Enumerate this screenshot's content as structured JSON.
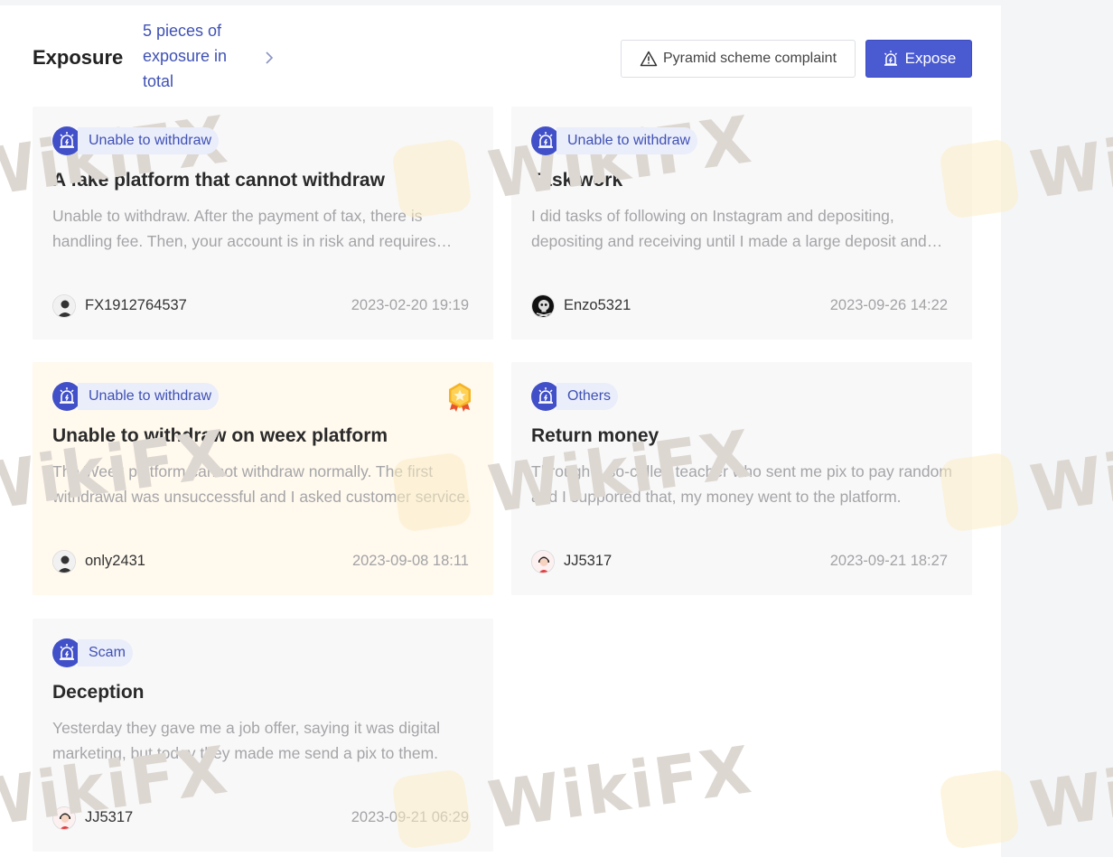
{
  "header": {
    "title": "Exposure",
    "summary": "5 pieces of exposure in total",
    "complaint_button": "Pyramid scheme complaint",
    "expose_button": "Expose"
  },
  "watermark": "WikiFX",
  "cards": [
    {
      "tag": "Unable to withdraw",
      "title": "A fake platform that cannot withdraw",
      "description": "Unable to withdraw. After the payment of tax, there is handling fee. Then, your account is in risk and requires verification fee.",
      "user": "FX1912764537",
      "time": "2023-02-20 19:19"
    },
    {
      "tag": "Unable to withdraw",
      "title": "Task work",
      "description": "I did tasks of following on Instagram and depositing, depositing and receiving until I made a large deposit and could not withdraw.",
      "user": "Enzo5321",
      "time": "2023-09-26 14:22"
    },
    {
      "tag": "Unable to withdraw",
      "title": "Unable to withdraw on weex platform",
      "description": "The Weex platform cannot withdraw normally. The first withdrawal was unsuccessful and I asked customer service.",
      "user": "only2431",
      "time": "2023-09-08 18:11"
    },
    {
      "tag": "Others",
      "title": "Return money",
      "description": "Through a so-called teacher who sent me pix to pay random and I supported that, my money went to the platform.",
      "user": "JJ5317",
      "time": "2023-09-21 18:27"
    },
    {
      "tag": "Scam",
      "title": "Deception",
      "description": "Yesterday they gave me a job offer, saying it was digital marketing, but today they made me send a pix to them.",
      "user": "JJ5317",
      "time": "2023-09-21 06:29"
    }
  ],
  "colors": {
    "accent": "#3f51b5",
    "expose_button": "#4a5ad1",
    "featured_card": "#fff9ee"
  },
  "icons": {
    "summary_arrow": "chevron-right-icon",
    "complaint": "warning-triangle-icon",
    "expose": "alarm-icon",
    "featured": "medal-star-icon"
  }
}
